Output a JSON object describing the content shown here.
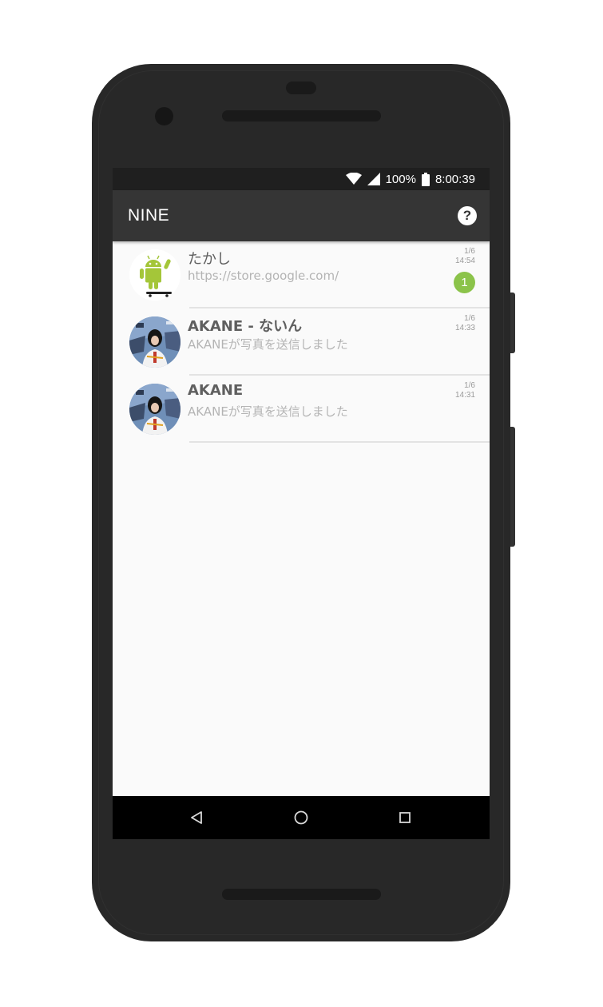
{
  "status_bar": {
    "battery": "100%",
    "time": "8:00:39",
    "icons": [
      "wifi-icon",
      "signal-icon",
      "battery-icon"
    ]
  },
  "app_bar": {
    "title": "NINE",
    "help_icon": "?"
  },
  "conversations": [
    {
      "name": "たかし",
      "message": "https://store.google.com/",
      "date": "1/6",
      "time": "14:54",
      "unread": "1",
      "avatar": "android-skateboard"
    },
    {
      "name": "AKANE - ないん",
      "message": "AKANEが写真を送信しました",
      "date": "1/6",
      "time": "14:33",
      "avatar": "photo-girl"
    },
    {
      "name": "AKANE",
      "message": "AKANEが写真を送信しました",
      "date": "1/6",
      "time": "14:31",
      "avatar": "photo-girl"
    }
  ],
  "colors": {
    "app_bar": "#353535",
    "accent_badge": "#8bc34a",
    "background": "#fafafa"
  }
}
